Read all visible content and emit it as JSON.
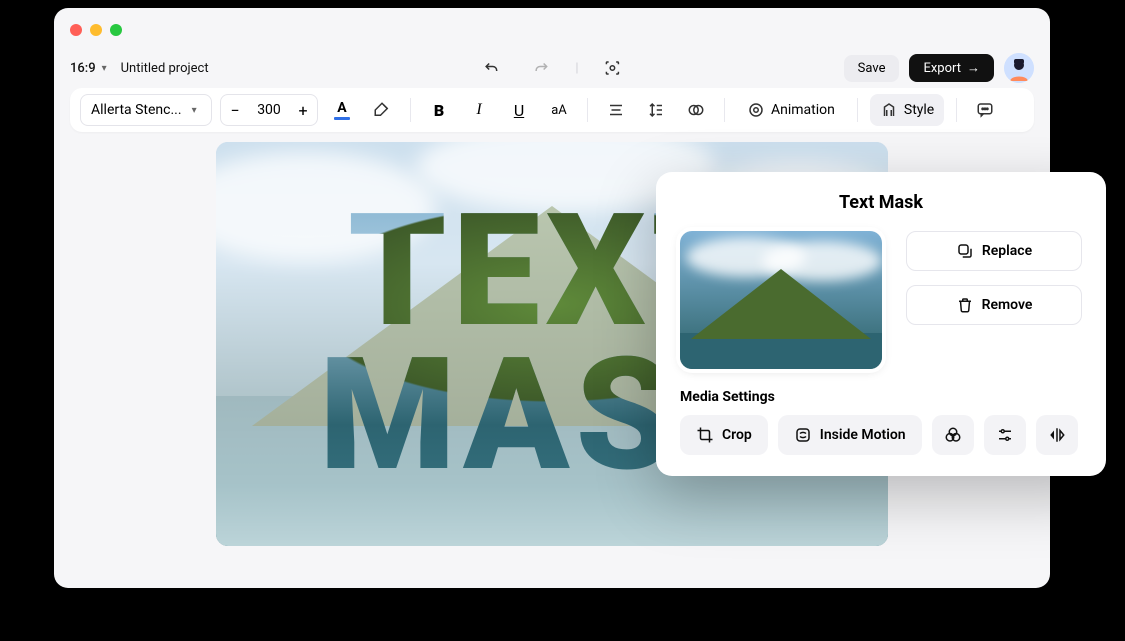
{
  "header": {
    "aspect_ratio": "16:9",
    "project_title": "Untitled project",
    "save_label": "Save",
    "export_label": "Export"
  },
  "toolbar": {
    "font_name": "Allerta Stenc...",
    "font_size": "300",
    "animation_label": "Animation",
    "style_label": "Style"
  },
  "canvas": {
    "text_line1": "TEXT",
    "text_line2": "MASK"
  },
  "panel": {
    "title": "Text Mask",
    "replace_label": "Replace",
    "remove_label": "Remove",
    "section_label": "Media Settings",
    "crop_label": "Crop",
    "inside_motion_label": "Inside Motion"
  }
}
